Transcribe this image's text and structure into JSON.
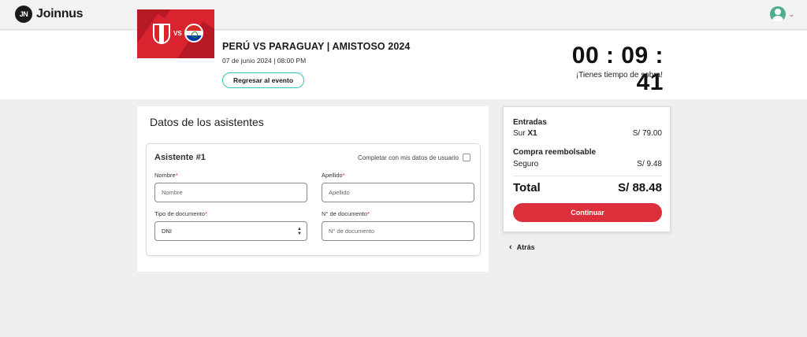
{
  "header": {
    "logo_mark": "JN",
    "logo_text": "Joinnus",
    "avatar_icon": "user-circle-icon",
    "menu_icon": "chevron-down-icon"
  },
  "event": {
    "title": "PERÚ VS PARAGUAY | AMISTOSO 2024",
    "date": "07 de junio 2024 | 08:00 PM",
    "image_vs": "VS",
    "back_button": "Regresar al evento"
  },
  "timer": {
    "value": "00 : 09 : 41",
    "note": "¡Tienes tiempo de sobra!"
  },
  "form": {
    "title": "Datos de los asistentes",
    "attendee_title": "Asistente #1",
    "fill_with_user_label": "Completar con mis datos de usuario",
    "fields": {
      "nombre_label": "Nombre",
      "nombre_placeholder": "Nombre",
      "apellido_label": "Apellido",
      "apellido_placeholder": "Apellido",
      "tipo_doc_label": "Tipo de documento",
      "tipo_doc_value": "DNI",
      "num_doc_label": "N° de documento",
      "num_doc_placeholder": "N° de documento"
    },
    "required_mark": "*"
  },
  "summary": {
    "entradas_heading": "Entradas",
    "ticket_zone": "Sur",
    "ticket_qty": "X1",
    "ticket_price": "S/ 79.00",
    "refund_heading": "Compra reembolsable",
    "insurance_label": "Seguro",
    "insurance_price": "S/ 9.48",
    "total_label": "Total",
    "total_value": "S/ 88.48",
    "continue_button": "Continuar"
  },
  "nav": {
    "back_label": "Atrás",
    "back_icon": "chevron-left-icon"
  },
  "colors": {
    "accent_red": "#dc2f3c",
    "teal": "#2ec4b6",
    "avatar_green": "#4fae8e"
  }
}
